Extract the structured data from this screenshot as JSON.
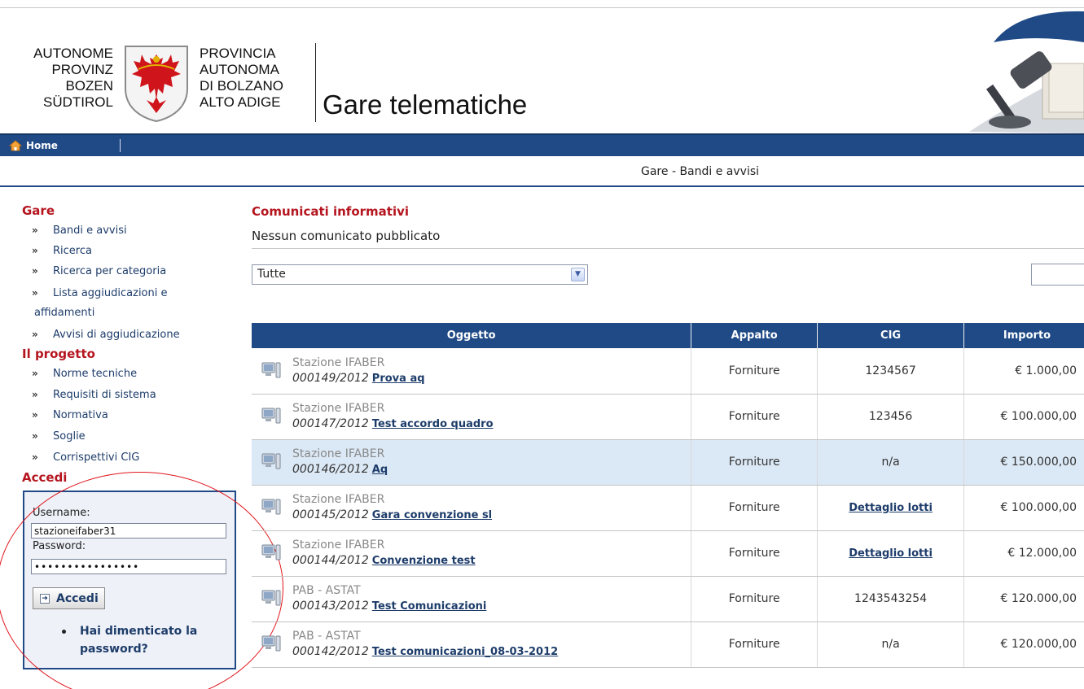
{
  "header": {
    "logo_left_lines": [
      "AUTONOME",
      "PROVINZ",
      "BOZEN",
      "SÜDTIROL"
    ],
    "logo_right_lines": [
      "PROVINCIA",
      "AUTONOMA",
      "DI BOLZANO",
      "ALTO ADIGE"
    ],
    "app_title": "Gare telematiche"
  },
  "nav": {
    "home_label": "Home"
  },
  "breadcrumb": "Gare - Bandi e avvisi",
  "sidebar": {
    "sections": [
      {
        "title": "Gare",
        "items": [
          "Bandi e avvisi",
          "Ricerca",
          "Ricerca per categoria",
          "Lista aggiudicazioni e",
          "Avvisi di aggiudicazione"
        ],
        "continuation": "affidamenti"
      },
      {
        "title": "Il progetto",
        "items": [
          "Norme tecniche",
          "Requisiti di sistema",
          "Normativa",
          "Soglie",
          "Corrispettivi CIG"
        ]
      },
      {
        "title": "Accedi"
      }
    ],
    "bullet": "»"
  },
  "login": {
    "username_label": "Username:",
    "username_value": "stazioneifaber31",
    "password_label": "Password:",
    "password_value": "••••••••••••••••",
    "submit_label": "Accedi",
    "forgot_label": "Hai dimenticato la password?"
  },
  "main": {
    "comm_title": "Comunicati informativi",
    "comm_text": "Nessun comunicato pubblicato",
    "filter_selected": "Tutte"
  },
  "table": {
    "headers": [
      "Oggetto",
      "Appalto",
      "CIG",
      "Importo"
    ],
    "rows": [
      {
        "station": "Stazione IFABER",
        "code": "000149/2012",
        "title": "Prova aq",
        "appalto": "Forniture",
        "cig": "1234567",
        "cig_is_link": false,
        "importo": "€ 1.000,00",
        "highlight": false
      },
      {
        "station": "Stazione IFABER",
        "code": "000147/2012",
        "title": "Test accordo quadro",
        "appalto": "Forniture",
        "cig": "123456",
        "cig_is_link": false,
        "importo": "€ 100.000,00",
        "highlight": false
      },
      {
        "station": "Stazione IFABER",
        "code": "000146/2012",
        "title": "Aq",
        "appalto": "Forniture",
        "cig": "n/a",
        "cig_is_link": false,
        "importo": "€ 150.000,00",
        "highlight": true
      },
      {
        "station": "Stazione IFABER",
        "code": "000145/2012",
        "title": "Gara convenzione sl",
        "appalto": "Forniture",
        "cig": "Dettaglio lotti",
        "cig_is_link": true,
        "importo": "€ 100.000,00",
        "highlight": false
      },
      {
        "station": "Stazione IFABER",
        "code": "000144/2012",
        "title": "Convenzione test",
        "appalto": "Forniture",
        "cig": "Dettaglio lotti",
        "cig_is_link": true,
        "importo": "€ 12.000,00",
        "highlight": false
      },
      {
        "station": "PAB - ASTAT",
        "code": "000143/2012",
        "title": "Test Comunicazioni",
        "appalto": "Forniture",
        "cig": "1243543254",
        "cig_is_link": false,
        "importo": "€ 120.000,00",
        "highlight": false
      },
      {
        "station": "PAB - ASTAT",
        "code": "000142/2012",
        "title": "Test comunicazioni_08-03-2012",
        "appalto": "Forniture",
        "cig": "n/a",
        "cig_is_link": false,
        "importo": "€ 120.000,00",
        "highlight": false
      }
    ]
  },
  "colors": {
    "nav_blue": "#1f4a86",
    "heading_red": "#b5151f",
    "link_blue": "#1d3c6a",
    "highlight_row": "#dbe8f5",
    "annotation_red": "#e0151d"
  },
  "icons": [
    "home-icon",
    "computer-icon",
    "arrow-right-icon",
    "dropdown-arrow-icon"
  ]
}
